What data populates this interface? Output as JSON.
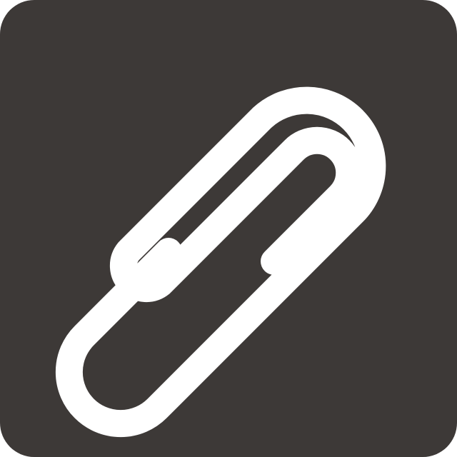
{
  "icon": {
    "name": "paperclip-icon",
    "background_color": "#3d3937",
    "glyph_color": "#ffffff"
  }
}
